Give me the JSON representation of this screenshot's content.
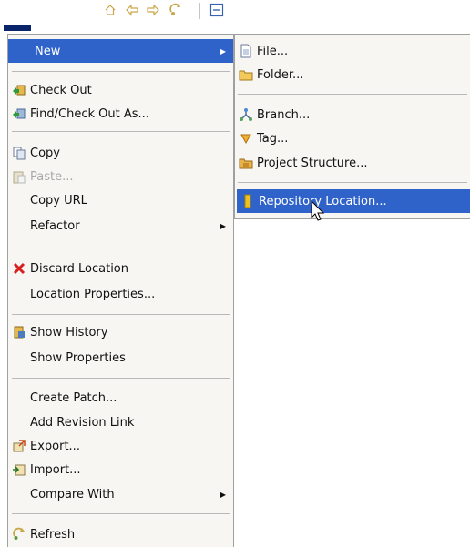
{
  "toolbar": {
    "icons": [
      "home-icon",
      "back-arrow-icon",
      "forward-arrow-icon",
      "sync-icon",
      "collapse-icon"
    ]
  },
  "context_menu": {
    "new": "New",
    "check_out": "Check Out",
    "find_check_out_as": "Find/Check Out As...",
    "copy": "Copy",
    "paste": "Paste...",
    "copy_url": "Copy URL",
    "refactor": "Refactor",
    "discard_location": "Discard Location",
    "location_properties": "Location Properties...",
    "show_history": "Show History",
    "show_properties": "Show Properties",
    "create_patch": "Create Patch...",
    "add_revision_link": "Add Revision Link",
    "export": "Export...",
    "import": "Import...",
    "compare_with": "Compare With",
    "refresh": "Refresh",
    "paste_enabled": false,
    "selected_item": "New"
  },
  "submenu_new": {
    "file": "File...",
    "folder": "Folder...",
    "branch": "Branch...",
    "tag": "Tag...",
    "project_structure": "Project Structure...",
    "repository_location": "Repository Location...",
    "selected_item": "Repository Location..."
  },
  "colors": {
    "selection": "#2f63c9",
    "menu_background": "#f7f6f3",
    "disabled_text": "#a8a8a8"
  }
}
